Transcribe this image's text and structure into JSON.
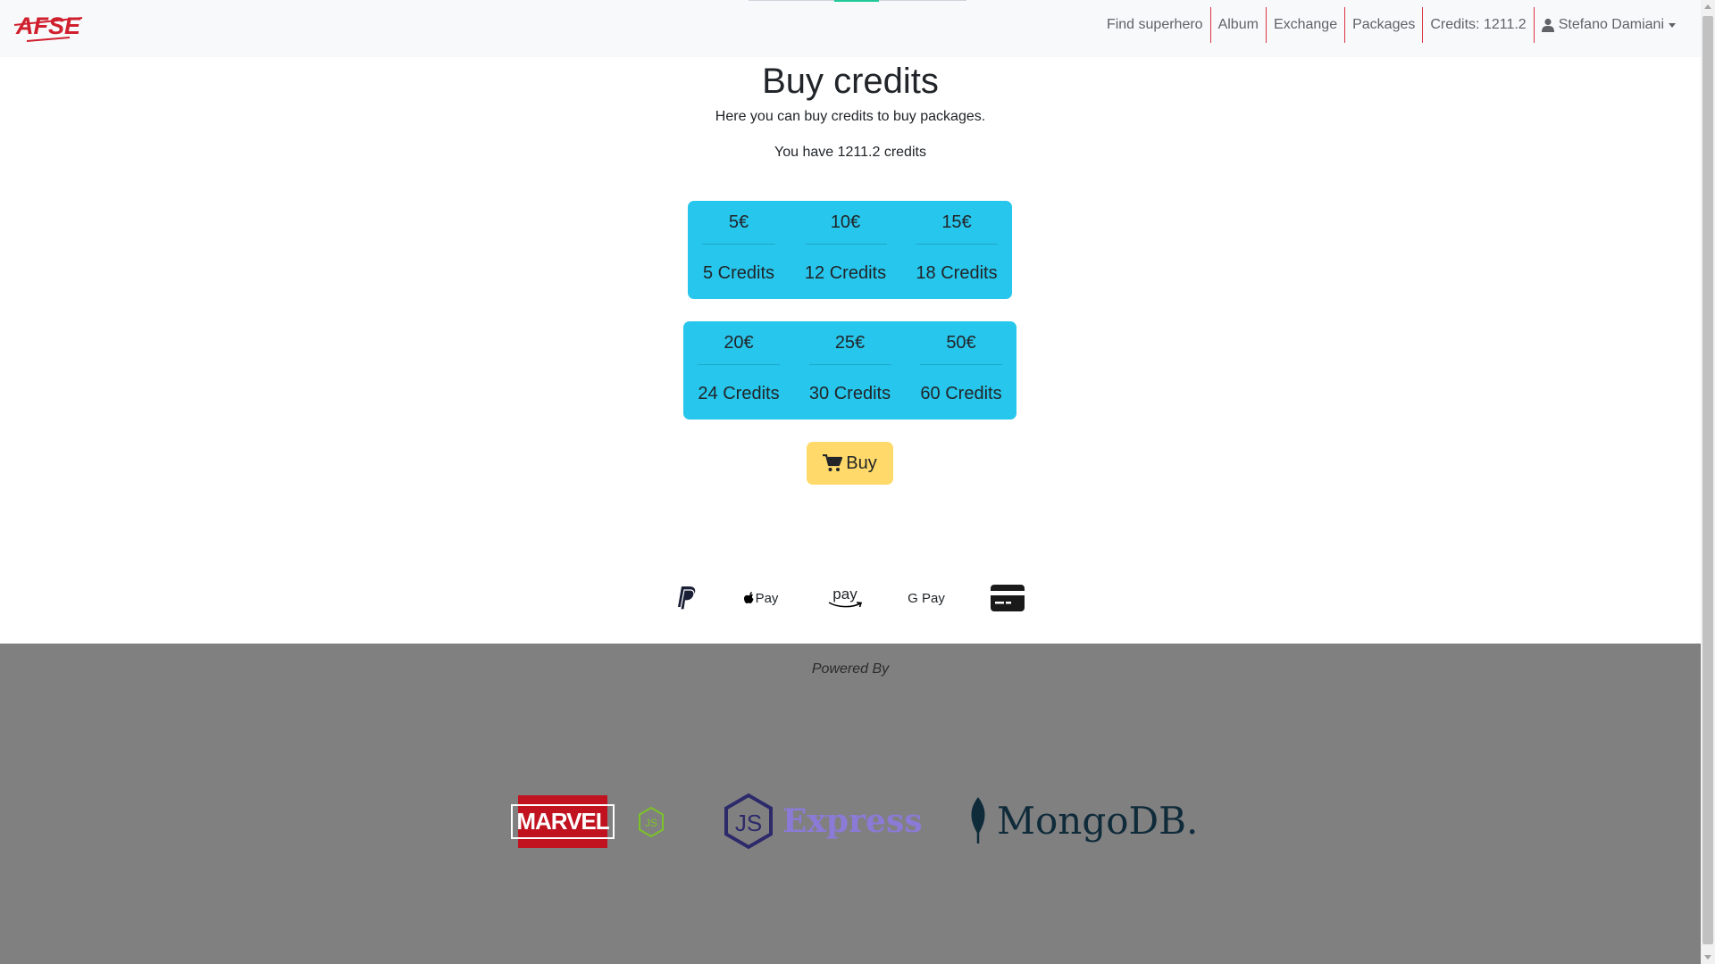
{
  "navbar": {
    "brand": "AFSE",
    "links": [
      "Find superhero",
      "Album",
      "Exchange",
      "Packages"
    ],
    "credits": "Credits: 1211.2",
    "user": "Stefano Damiani"
  },
  "main": {
    "title": "Buy credits",
    "subtitle": "Here you can buy credits to buy packages.",
    "credit_line": "You have 1211.2 credits",
    "packs_row1": [
      {
        "price": "5€",
        "credits": "5 Credits"
      },
      {
        "price": "10€",
        "credits": "12 Credits"
      },
      {
        "price": "15€",
        "credits": "18 Credits"
      }
    ],
    "packs_row2": [
      {
        "price": "20€",
        "credits": "24 Credits"
      },
      {
        "price": "25€",
        "credits": "30 Credits"
      },
      {
        "price": "50€",
        "credits": "60 Credits"
      }
    ],
    "buy_label": "Buy",
    "payment_methods": {
      "apple": "Pay",
      "amazon": "pay",
      "google": "G Pay"
    }
  },
  "footer": {
    "powered_by": "Powered By",
    "logos": {
      "marvel": "MARVEL",
      "node": "JS",
      "express": "Express",
      "express_badge": "JS",
      "mongodb": "MongoDB."
    }
  },
  "colors": {
    "pack_bg": "#27c6ec",
    "buy_bg": "#ffda6a",
    "footer_bg": "#808080",
    "nav_separator": "#dc3545",
    "brand_red": "#d0202e"
  },
  "icons": [
    "user-icon",
    "cart-icon",
    "paypal-icon",
    "apple-icon",
    "amazon-icon",
    "google-icon",
    "credit-card-icon",
    "mongodb-leaf-icon",
    "nodejs-hex-icon"
  ]
}
